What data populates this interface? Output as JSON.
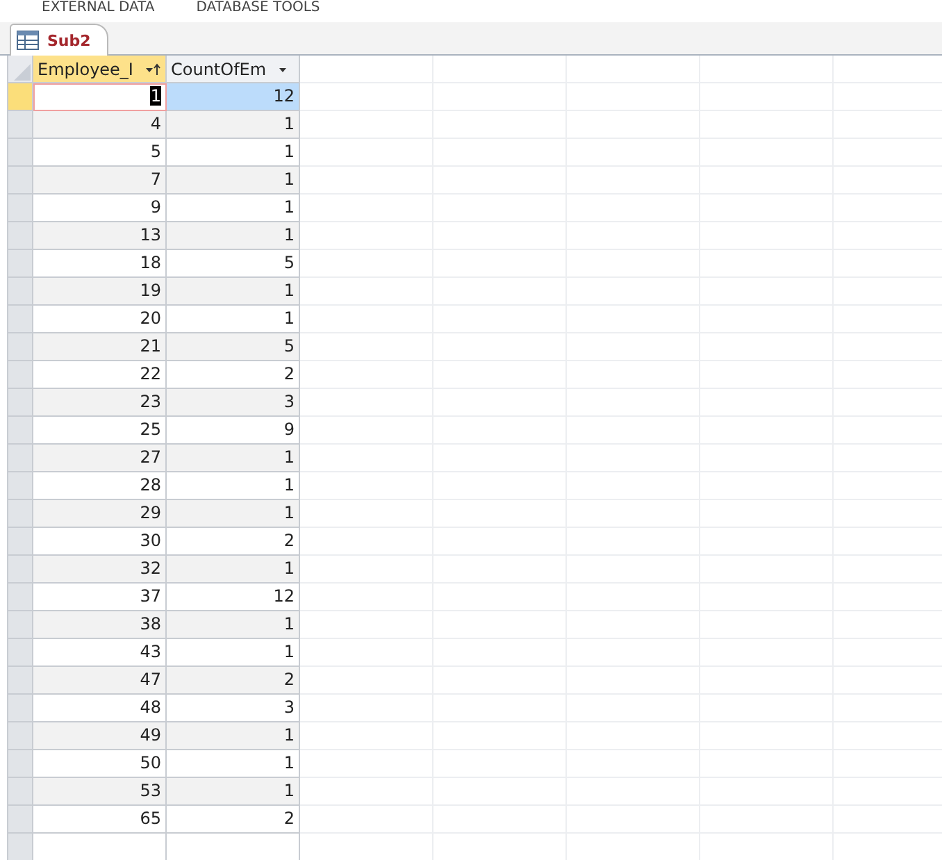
{
  "ribbon_tabs": [
    "EXTERNAL DATA",
    "DATABASE TOOLS"
  ],
  "document_tab": {
    "title": "Sub2"
  },
  "table": {
    "columns": [
      {
        "label": "Employee_I",
        "active": true,
        "sorted": true
      },
      {
        "label": "CountOfEm",
        "active": false,
        "sorted": false
      }
    ],
    "rows": [
      {
        "cells": [
          "1",
          "12"
        ],
        "selected": true
      },
      {
        "cells": [
          "4",
          "1"
        ],
        "selected": false
      },
      {
        "cells": [
          "5",
          "1"
        ],
        "selected": false
      },
      {
        "cells": [
          "7",
          "1"
        ],
        "selected": false
      },
      {
        "cells": [
          "9",
          "1"
        ],
        "selected": false
      },
      {
        "cells": [
          "13",
          "1"
        ],
        "selected": false
      },
      {
        "cells": [
          "18",
          "5"
        ],
        "selected": false
      },
      {
        "cells": [
          "19",
          "1"
        ],
        "selected": false
      },
      {
        "cells": [
          "20",
          "1"
        ],
        "selected": false
      },
      {
        "cells": [
          "21",
          "5"
        ],
        "selected": false
      },
      {
        "cells": [
          "22",
          "2"
        ],
        "selected": false
      },
      {
        "cells": [
          "23",
          "3"
        ],
        "selected": false
      },
      {
        "cells": [
          "25",
          "9"
        ],
        "selected": false
      },
      {
        "cells": [
          "27",
          "1"
        ],
        "selected": false
      },
      {
        "cells": [
          "28",
          "1"
        ],
        "selected": false
      },
      {
        "cells": [
          "29",
          "1"
        ],
        "selected": false
      },
      {
        "cells": [
          "30",
          "2"
        ],
        "selected": false
      },
      {
        "cells": [
          "32",
          "1"
        ],
        "selected": false
      },
      {
        "cells": [
          "37",
          "12"
        ],
        "selected": false
      },
      {
        "cells": [
          "38",
          "1"
        ],
        "selected": false
      },
      {
        "cells": [
          "43",
          "1"
        ],
        "selected": false
      },
      {
        "cells": [
          "47",
          "2"
        ],
        "selected": false
      },
      {
        "cells": [
          "48",
          "3"
        ],
        "selected": false
      },
      {
        "cells": [
          "49",
          "1"
        ],
        "selected": false
      },
      {
        "cells": [
          "50",
          "1"
        ],
        "selected": false
      },
      {
        "cells": [
          "53",
          "1"
        ],
        "selected": false
      },
      {
        "cells": [
          "65",
          "2"
        ],
        "selected": false
      }
    ]
  }
}
